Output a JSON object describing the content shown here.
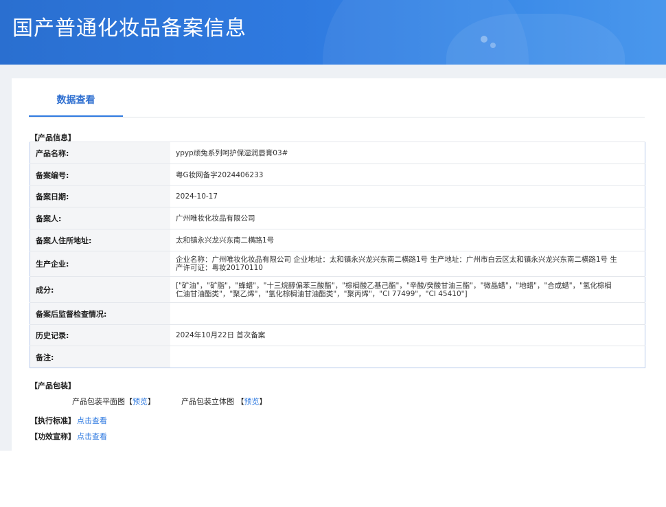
{
  "header": {
    "title": "国产普通化妆品备案信息"
  },
  "tabs": {
    "active": "数据查看"
  },
  "product_info": {
    "section_label": "【产品信息】",
    "rows": [
      {
        "label": "产品名称:",
        "value": "ypyp顽兔系列呵护保湿润唇膏03#"
      },
      {
        "label": "备案编号:",
        "value": "粤G妆网备字2024406233"
      },
      {
        "label": "备案日期:",
        "value": "2024-10-17"
      },
      {
        "label": "备案人:",
        "value": "广州唯妆化妆品有限公司"
      },
      {
        "label": "备案人住所地址:",
        "value": "太和镇永兴龙兴东南二横路1号"
      },
      {
        "label": "生产企业:",
        "value": "企业名称：广州唯妆化妆品有限公司 企业地址：太和镇永兴龙兴东南二横路1号 生产地址：广州市白云区太和镇永兴龙兴东南二横路1号 生产许可证：粤妆20170110"
      },
      {
        "label": "成分:",
        "value": "[\"矿油\"，\"矿脂\"，\"蜂蜡\"，\"十三烷醇偏苯三酸酯\"，\"棕榈酸乙基己酯\"，\"辛酸/癸酸甘油三酯\"，\"微晶蜡\"，\"地蜡\"，\"合成蜡\"，\"氢化棕榈仁油甘油酯类\"，\"聚乙烯\"，\"氢化棕榈油甘油酯类\"，\"聚丙烯\"，\"CI 77499\"，\"CI 45410\"]"
      },
      {
        "label": "备案后监督检查情况:",
        "value": ""
      },
      {
        "label": "历史记录:",
        "value": "2024年10月22日 首次备案"
      },
      {
        "label": "备注:",
        "value": ""
      }
    ]
  },
  "packaging": {
    "section_label": "【产品包装】",
    "flat_label": "产品包装平面图",
    "stereo_label": "产品包装立体图",
    "bracket_open": "【",
    "bracket_close": "】",
    "preview_label": "预览"
  },
  "standards": {
    "label": "【执行标准】",
    "link": "点击查看"
  },
  "claims": {
    "label": "【功效宣称】",
    "link": "点击查看"
  }
}
